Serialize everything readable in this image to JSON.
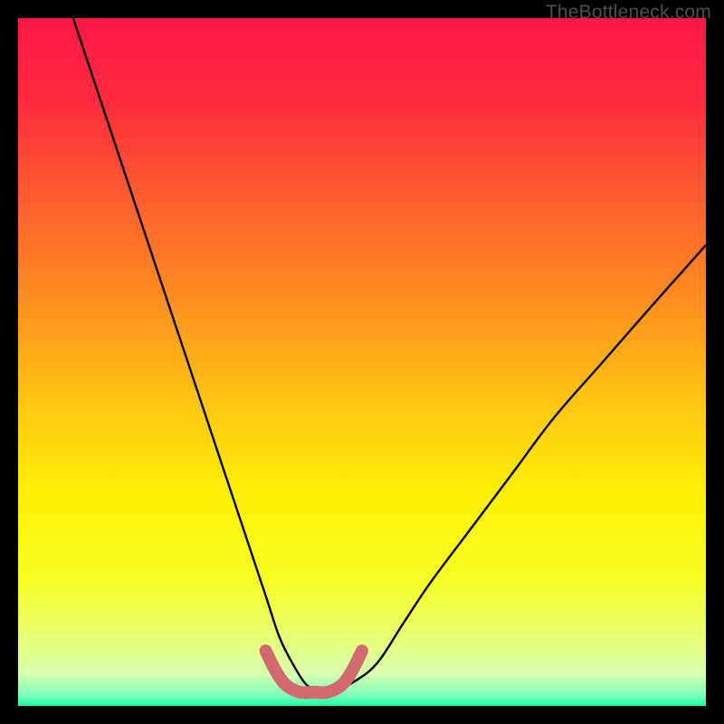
{
  "watermark": "TheBottleneck.com",
  "gradient_stops": [
    {
      "offset": 0.0,
      "color": "#ff1846"
    },
    {
      "offset": 0.12,
      "color": "#ff2a3f"
    },
    {
      "offset": 0.25,
      "color": "#ff5a2f"
    },
    {
      "offset": 0.4,
      "color": "#ff8a20"
    },
    {
      "offset": 0.55,
      "color": "#ffc313"
    },
    {
      "offset": 0.7,
      "color": "#fff205"
    },
    {
      "offset": 0.82,
      "color": "#f7ff25"
    },
    {
      "offset": 0.9,
      "color": "#e8ff75"
    },
    {
      "offset": 0.955,
      "color": "#d6ffb0"
    },
    {
      "offset": 0.985,
      "color": "#7bffbc"
    },
    {
      "offset": 1.0,
      "color": "#19ff9c"
    }
  ],
  "chart_data": {
    "type": "line",
    "title": "",
    "xlabel": "",
    "ylabel": "",
    "xlim": [
      0,
      100
    ],
    "ylim": [
      0,
      100
    ],
    "grid": false,
    "legend": false,
    "series": [
      {
        "name": "bottleneck-curve",
        "color": "#000000",
        "x": [
          8,
          12,
          16,
          20,
          24,
          28,
          32,
          36,
          38,
          40,
          42,
          44,
          46,
          48,
          52,
          56,
          60,
          66,
          72,
          78,
          85,
          92,
          100
        ],
        "y": [
          100,
          88,
          76,
          64,
          52,
          40,
          28,
          16,
          10,
          6,
          3,
          2,
          2,
          3,
          6,
          12,
          18,
          26,
          34,
          42,
          50,
          58,
          67
        ]
      },
      {
        "name": "bottleneck-valley-highlight",
        "color": "#d06a6f",
        "x": [
          36.0,
          37.5,
          39.0,
          41.0,
          43.0,
          45.0,
          47.0,
          48.5,
          50.0
        ],
        "y": [
          8.0,
          5.0,
          3.0,
          2.0,
          2.0,
          2.0,
          3.0,
          5.0,
          8.0
        ]
      }
    ],
    "annotations": []
  }
}
